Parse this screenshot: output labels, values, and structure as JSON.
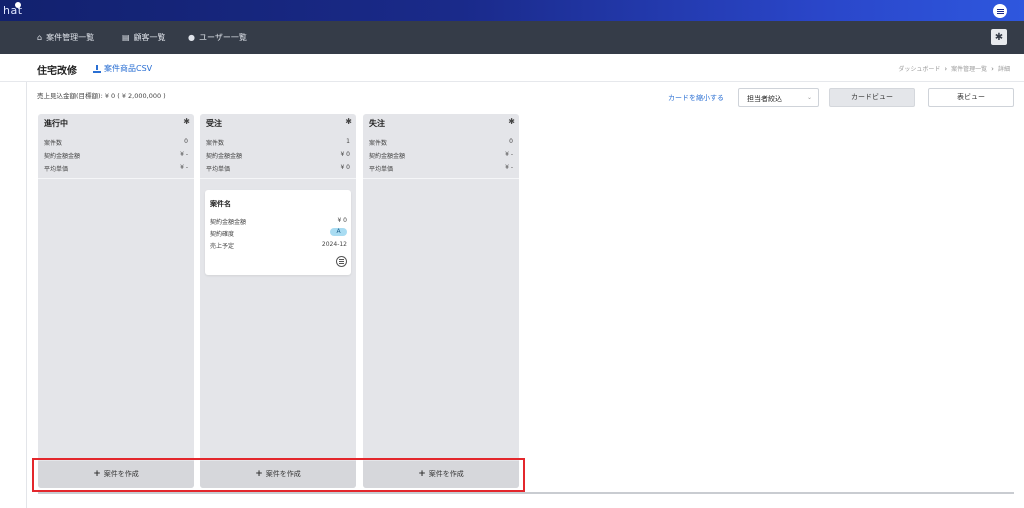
{
  "app": {
    "logo": "hat"
  },
  "nav": {
    "items": [
      {
        "label": "案件管理一覧",
        "icon": "home-icon"
      },
      {
        "label": "顧客一覧",
        "icon": "building-icon"
      },
      {
        "label": "ユーザー一覧",
        "icon": "user-icon"
      }
    ]
  },
  "page": {
    "title": "住宅改修",
    "csv_label": "案件商品CSV",
    "breadcrumb": [
      "ダッシュボード",
      "案件管理一覧",
      "詳細"
    ]
  },
  "sales_summary": "売上見込金額(目標額): ¥ 0 ( ¥ 2,000,000 )",
  "controls": {
    "shrink_label": "カードを縮小する",
    "assignee_filter": "担当者絞込",
    "card_view_label": "カードビュー",
    "table_view_label": "表ビュー"
  },
  "stat_labels": {
    "count": "案件数",
    "contract_amount": "契約金額金額",
    "avg_price": "平均単価"
  },
  "columns": [
    {
      "title": "進行中",
      "count": "0",
      "contract_amount": "¥ -",
      "avg_price": "¥ -",
      "create_label": "案件を作成"
    },
    {
      "title": "受注",
      "count": "1",
      "contract_amount": "¥ 0",
      "avg_price": "¥ 0",
      "create_label": "案件を作成"
    },
    {
      "title": "失注",
      "count": "0",
      "contract_amount": "¥ -",
      "avg_price": "¥ -",
      "create_label": "案件を作成"
    }
  ],
  "card": {
    "title": "案件名",
    "contract_amount_label": "契約金額金額",
    "contract_amount": "¥ 0",
    "certainty_label": "契約確度",
    "certainty": "A",
    "sales_plan_label": "売上予定",
    "sales_plan": "2024-12"
  },
  "colors": {
    "nav_bg": "#353c48",
    "accent": "#2a6fd3",
    "highlight": "#e3272c",
    "column_bg": "#e4e5e9"
  }
}
